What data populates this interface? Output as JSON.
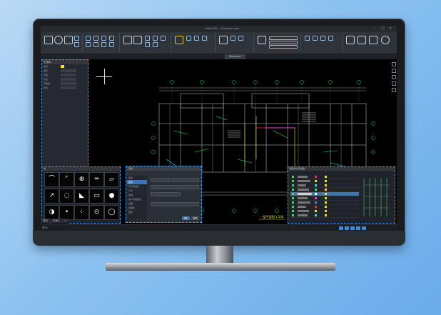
{
  "window": {
    "title": "GstarCAD — Drawing1.dwg",
    "minimize": "–",
    "maximize": "□",
    "close": "×"
  },
  "file_tab": "Drawing1",
  "props": {
    "header": "无选择",
    "rows": [
      "颜色",
      "图层",
      "线型",
      "线宽",
      "透明度",
      "厚度"
    ]
  },
  "blocks_panel": {
    "header": "块"
  },
  "dialog": {
    "header": "选项",
    "items": [
      "文件",
      "显示",
      "打开和保存",
      "打印",
      "系统",
      "用户系统配置",
      "绘图",
      "选择集",
      "配置"
    ],
    "ok": "确定",
    "cancel": "取消"
  },
  "layers_panel": {
    "header": "图层特性管理器"
  },
  "model_tabs": [
    "模型",
    "布局1",
    "+"
  ],
  "status": {
    "command": "命令:"
  },
  "drawing_title": "一层平面图 1:100"
}
